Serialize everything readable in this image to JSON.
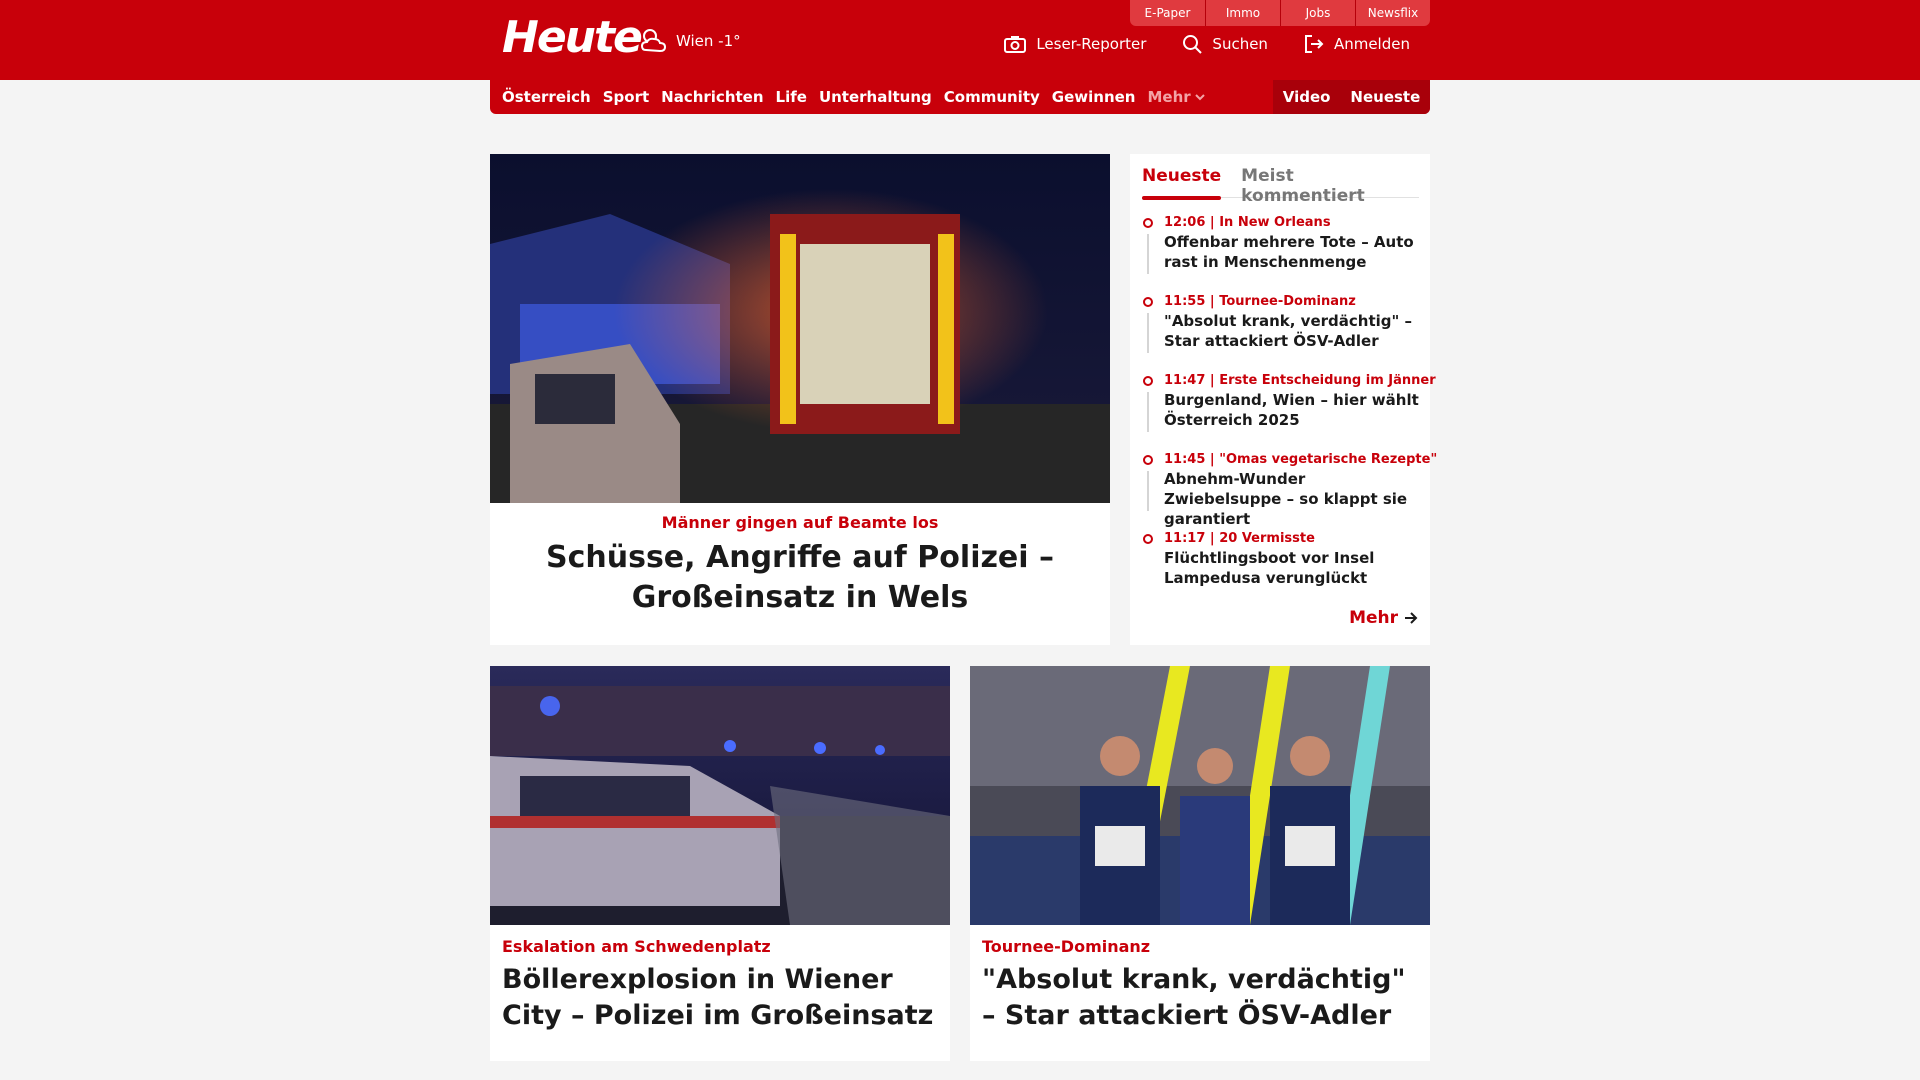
{
  "header": {
    "logo": "Heute",
    "weather": "Wien -1°",
    "services": [
      "E-Paper",
      "Immo",
      "Jobs",
      "Newsflix"
    ],
    "actions": {
      "reporter": "Leser-Reporter",
      "search": "Suchen",
      "login": "Anmelden"
    },
    "brand_color": "#c8000a"
  },
  "nav": {
    "items": [
      "Österreich",
      "Sport",
      "Nachrichten",
      "Life",
      "Unterhaltung",
      "Community",
      "Gewinnen"
    ],
    "more": "Mehr",
    "video": "Video",
    "latest": "Neueste"
  },
  "hero": {
    "kicker": "Männer gingen auf Beamte los",
    "headline": "Schüsse, Angriffe auf Polizei – Großeinsatz in Wels"
  },
  "sidebar": {
    "tabs": [
      "Neueste",
      "Meist kommentiert"
    ],
    "items": [
      {
        "time": "12:06",
        "tag": "In New Orleans",
        "title": "Offenbar mehrere Tote – Auto rast in Menschenmenge"
      },
      {
        "time": "11:55",
        "tag": "Tournee-Dominanz",
        "title": "\"Absolut krank, verdächtig\" – Star attackiert ÖSV-Adler"
      },
      {
        "time": "11:47",
        "tag": "Erste Entscheidung im Jänner",
        "title": "Burgenland, Wien – hier wählt Österreich 2025"
      },
      {
        "time": "11:45",
        "tag": "\"Omas vegetarische Rezepte\"",
        "title": "Abnehm-Wunder Zwiebelsuppe – so klappt sie garantiert"
      },
      {
        "time": "11:17",
        "tag": "20 Vermisste",
        "title": "Flüchtlingsboot vor Insel Lampedusa verunglückt"
      }
    ],
    "more": "Mehr"
  },
  "cards": [
    {
      "kicker": "Eskalation am Schwedenplatz",
      "headline": "Böllerexplosion in Wiener City – Polizei im Großeinsatz"
    },
    {
      "kicker": "Tournee-Dominanz",
      "headline": "\"Absolut krank, verdächtig\" – Star attackiert ÖSV-Adler"
    }
  ]
}
